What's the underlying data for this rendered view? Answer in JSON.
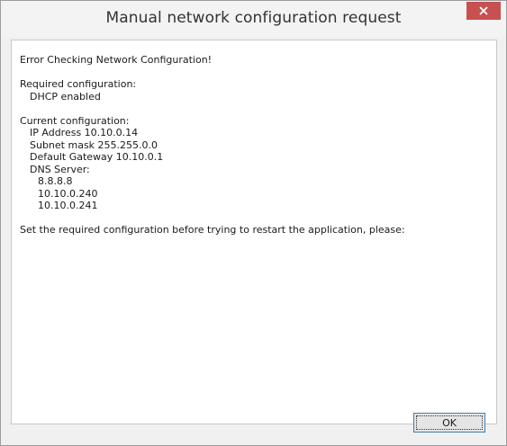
{
  "window": {
    "title": "Manual network configuration request",
    "close_icon": "close-icon"
  },
  "message": {
    "error_heading": "Error Checking Network Configuration!",
    "required_label": "Required configuration:",
    "required_value": "DHCP enabled",
    "current_label": "Current configuration:",
    "ip_address": "IP Address 10.10.0.14",
    "subnet_mask": "Subnet mask 255.255.0.0",
    "default_gateway": "Default Gateway 10.10.0.1",
    "dns_label": "DNS Server:",
    "dns_servers": [
      "8.8.8.8",
      "10.10.0.240",
      "10.10.0.241"
    ],
    "instruction": "Set the required configuration before trying to restart the application, please:"
  },
  "buttons": {
    "ok_label": "OK"
  },
  "colors": {
    "close_button": "#c75050",
    "window_background": "#f0f0f0",
    "content_background": "#ffffff",
    "ok_button_border": "#3c7fb1"
  }
}
